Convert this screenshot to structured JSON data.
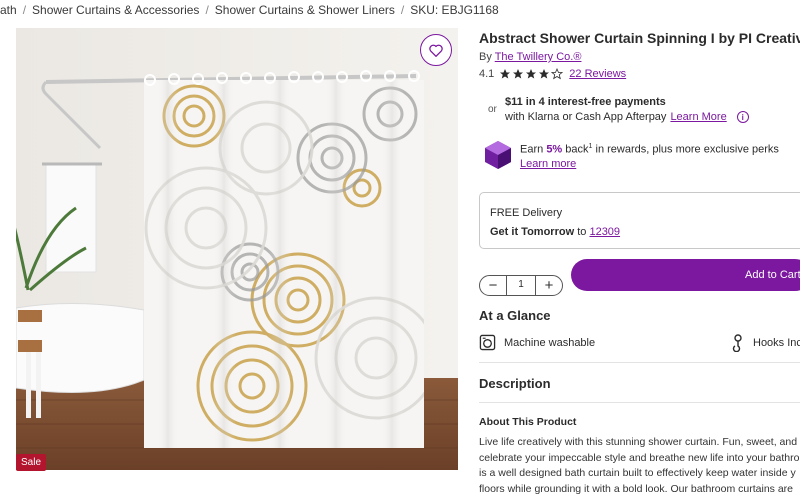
{
  "breadcrumb": {
    "items": [
      "ath",
      "Shower Curtains & Accessories",
      "Shower Curtains & Shower Liners"
    ],
    "separator": "/",
    "sku": "SKU: EBJG1168"
  },
  "product": {
    "title": "Abstract Shower Curtain Spinning I by PI Creative Art",
    "by_label": "By",
    "brand": "The Twillery Co.®",
    "rating_value": "4.1",
    "rating_fraction": 0.82,
    "reviews_link": "22 Reviews",
    "sale_badge": "Sale"
  },
  "payment": {
    "or_label": "or",
    "line1": "$11 in 4 interest-free payments",
    "line2": "with Klarna or Cash App Afterpay",
    "learn_more": "Learn More",
    "info_icon": "i"
  },
  "rewards": {
    "earn": "Earn",
    "percent": "5%",
    "back": "back",
    "superscript": "1",
    "rest": "in rewards, plus more exclusive perks",
    "learn_more": "Learn more"
  },
  "delivery": {
    "free": "FREE Delivery",
    "tomorrow": "Get it Tomorrow",
    "to": "to",
    "zip": "12309"
  },
  "quantity": {
    "minus": "−",
    "value": "1",
    "plus": "+"
  },
  "cart": {
    "label": "Add to Cart"
  },
  "glance": {
    "heading": "At a Glance",
    "machine": "Machine washable",
    "hooks": "Hooks Included"
  },
  "description": {
    "heading": "Description",
    "about_heading": "About This Product",
    "lines": [
      "Live life creatively with this stunning shower curtain. Fun, sweet, and d",
      "celebrate your impeccable style and breathe new life into your bathro",
      "is a well designed bath curtain built to effectively keep water inside y",
      "floors while grounding it with a bold look. Our bathroom curtains are"
    ]
  },
  "colors": {
    "accent": "#7b189f",
    "sale": "#b3152e",
    "gold": "#c9a24b",
    "grey": "#9a9a9a"
  }
}
